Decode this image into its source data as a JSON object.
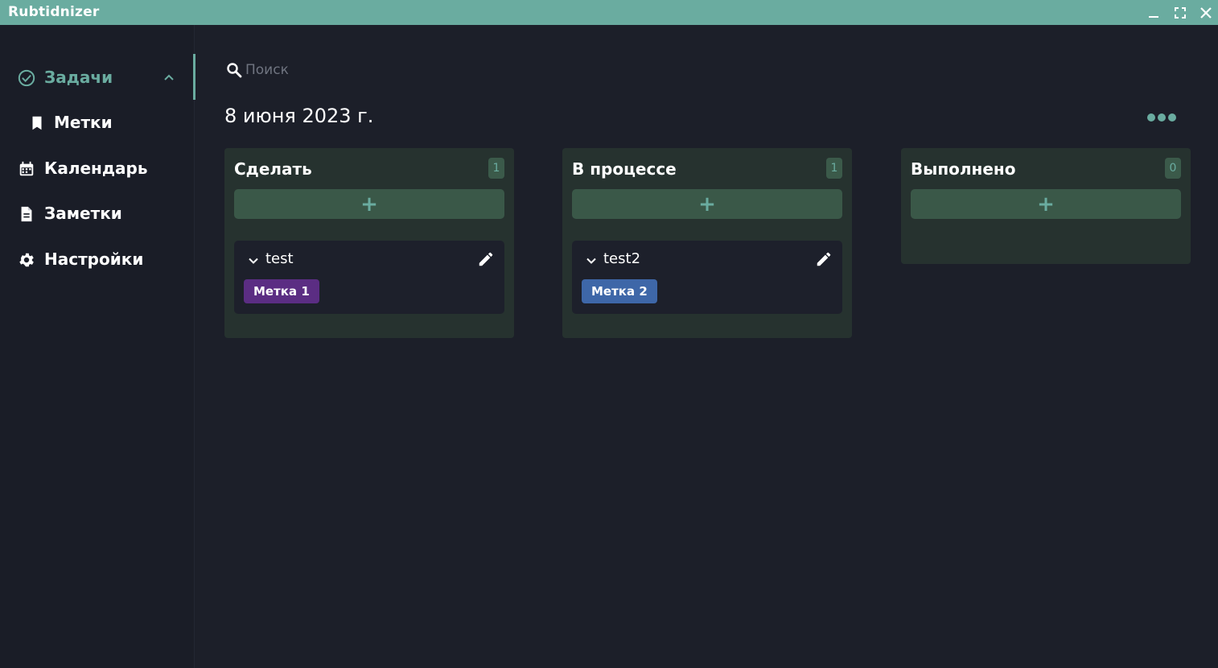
{
  "window": {
    "title": "Rubtidnizer",
    "controls": [
      "minimize-icon",
      "maximize-icon",
      "close-icon"
    ],
    "bar_color": "#6aaca0"
  },
  "sidebar": {
    "items": [
      {
        "label": "Задачи",
        "icon": "check-circle-icon",
        "active": true,
        "expanded": true
      },
      {
        "label": "Метки",
        "icon": "bookmark-icon",
        "sub": true
      },
      {
        "label": "Календарь",
        "icon": "calendar-icon"
      },
      {
        "label": "Заметки",
        "icon": "document-icon"
      },
      {
        "label": "Настройки",
        "icon": "gear-icon"
      }
    ]
  },
  "search": {
    "placeholder": "Поиск",
    "value": ""
  },
  "date_heading": "8 июня 2023 г.",
  "columns": [
    {
      "title": "Сделать",
      "count": "1",
      "add_label": "+",
      "tasks": [
        {
          "title": "test",
          "tag": {
            "label": "Метка 1",
            "color": "#5b2d83"
          }
        }
      ]
    },
    {
      "title": "В процессе",
      "count": "1",
      "add_label": "+",
      "tasks": [
        {
          "title": "test2",
          "tag": {
            "label": "Метка 2",
            "color": "#3e67a8"
          }
        }
      ]
    },
    {
      "title": "Выполнено",
      "count": "0",
      "add_label": "+",
      "tasks": []
    }
  ],
  "colors": {
    "accent": "#6aaca0",
    "background": "#1c1f29",
    "sidebar": "#1a1d27",
    "column": "#26322f",
    "add_button": "#3a5848",
    "card": "#1d202b"
  }
}
